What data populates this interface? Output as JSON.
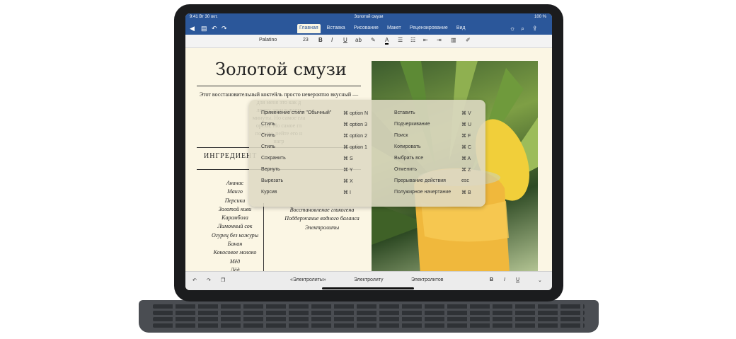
{
  "status": {
    "time": "9:41",
    "date": "Вт 30 окт.",
    "battery": "100 %"
  },
  "document": {
    "name": "Золотой смузи",
    "title": "Золотой смузи",
    "intro": [
      "Этот восстановительный коктейль просто невероятно вкусный —",
      "для меня это как д",
      "легко: закидываем",
      "минуты. Но самое гла",
      "орехи. Но самое гл",
      "пользы, пейте его н",
      "нагр"
    ],
    "ingredients_heading": "ИНГРЕДИЕНТ",
    "ingredients": [
      "Ананас",
      "Манго",
      "Персики",
      "Золотой киви",
      "Карамбола",
      "Лимонный сок",
      "Огурец без кожуры",
      "Банан",
      "Кокосовое молоко",
      "Мёд",
      "Лёд"
    ],
    "benefits": [
      "Восстановление гликогена",
      "Поддержание водного баланса",
      "Электролиты"
    ]
  },
  "ribbon": {
    "tabs": [
      "Главная",
      "Вставка",
      "Рисование",
      "Макет",
      "Рецензирование",
      "Вид"
    ],
    "active_tab": "Главная",
    "font": "Palatino",
    "size": "23"
  },
  "shortcuts": {
    "left": [
      {
        "label": "Применение стиля \"Обычный\"",
        "key": "⌘ option N"
      },
      {
        "label": "Стиль",
        "key": "⌘ option 3"
      },
      {
        "label": "Стиль",
        "key": "⌘ option 2"
      },
      {
        "label": "Стиль",
        "key": "⌘ option 1"
      },
      {
        "label": "Сохранить",
        "key": "⌘ S"
      },
      {
        "label": "Вернуть",
        "key": "⌘ Y"
      },
      {
        "label": "Вырезать",
        "key": "⌘ X"
      },
      {
        "label": "Курсив",
        "key": "⌘ I"
      }
    ],
    "right": [
      {
        "label": "Вставить",
        "key": "⌘ V"
      },
      {
        "label": "Подчеркивание",
        "key": "⌘ U"
      },
      {
        "label": "Поиск",
        "key": "⌘ F"
      },
      {
        "label": "Копировать",
        "key": "⌘ C"
      },
      {
        "label": "Выбрать все",
        "key": "⌘ A"
      },
      {
        "label": "Отменить",
        "key": "⌘ Z"
      },
      {
        "label": "Прерывание действия",
        "key": "esc"
      },
      {
        "label": "Полужирное начертание",
        "key": "⌘ B"
      }
    ]
  },
  "predictive": [
    "«Электролиты»",
    "Электролиту",
    "Электролитов"
  ],
  "format_buttons": {
    "bold": "B",
    "italic": "I",
    "underline": "U"
  },
  "icons": {
    "back": "back-icon",
    "file": "file-icon",
    "undo": "undo-icon",
    "redo": "redo-icon",
    "lightbulb": "lightbulb-icon",
    "search": "search-icon",
    "share": "share-icon"
  }
}
